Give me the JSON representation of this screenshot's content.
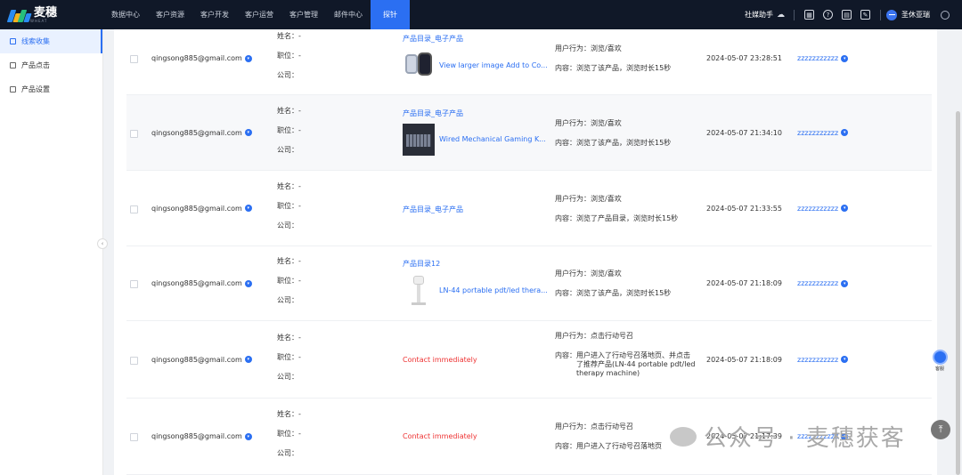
{
  "app": {
    "logo_text": "麦穗",
    "logo_sub": "WHEAT",
    "nav": [
      "数据中心",
      "客户资源",
      "客户开发",
      "客户运营",
      "客户管理",
      "邮件中心",
      "探针"
    ],
    "active_nav": "探针",
    "assistant": "社媒助手",
    "user": "圣休亚瑞",
    "accent": "#2b6ff2"
  },
  "sidebar": {
    "items": [
      {
        "label": "线索收集",
        "icon": "list-icon",
        "active": true
      },
      {
        "label": "产品点击",
        "icon": "click-icon",
        "active": false
      },
      {
        "label": "产品设置",
        "icon": "grid-icon",
        "active": false
      }
    ]
  },
  "labels": {
    "name": "姓名：-",
    "position": "职位：-",
    "company": "公司：",
    "behavior_prefix": "用户行为：",
    "content_prefix": "内容："
  },
  "rows": [
    {
      "email": "qingsong885@gmail.com",
      "category": "产品目录_电子产品",
      "product": "View larger image Add to Co...",
      "thumb": "watch",
      "behavior": "用户行为：浏览/喜欢",
      "content": "内容：浏览了该产品，浏览时长15秒",
      "time": "2024-05-07 23:28:51",
      "owner": "zzzzzzzzzzz"
    },
    {
      "email": "qingsong885@gmail.com",
      "category": "产品目录_电子产品",
      "product": "Wired Mechanical Gaming K...",
      "thumb": "keyboard",
      "behavior": "用户行为：浏览/喜欢",
      "content": "内容：浏览了该产品，浏览时长15秒",
      "time": "2024-05-07 21:34:10",
      "owner": "zzzzzzzzzzz"
    },
    {
      "email": "qingsong885@gmail.com",
      "category": "产品目录_电子产品",
      "product": "",
      "thumb": "",
      "behavior": "用户行为：浏览/喜欢",
      "content": "内容：浏览了产品目录，浏览时长15秒",
      "time": "2024-05-07 21:33:55",
      "owner": "zzzzzzzzzzz"
    },
    {
      "email": "qingsong885@gmail.com",
      "category": "产品目录12",
      "product": "LN-44 portable pdt/led thera...",
      "thumb": "device",
      "behavior": "用户行为：浏览/喜欢",
      "content": "内容：浏览了该产品，浏览时长15秒",
      "time": "2024-05-07 21:18:09",
      "owner": "zzzzzzzzzzz"
    },
    {
      "email": "qingsong885@gmail.com",
      "category": "Contact immediately",
      "product": "",
      "thumb": "",
      "behavior": "用户行为：点击行动号召",
      "content_lines": [
        "内容：用户进入了行动号召落地页、并点击",
        "了推荐产品(LN-44 portable pdt/led",
        "therapy machine)"
      ],
      "time": "2024-05-07 21:18:09",
      "owner": "zzzzzzzzzzz"
    },
    {
      "email": "qingsong885@gmail.com",
      "category": "Contact immediately",
      "product": "",
      "thumb": "",
      "behavior": "用户行为：点击行动号召",
      "content": "内容：用户进入了行动号召落地页",
      "time": "2024-05-07 21:17:39",
      "owner": "zzzzzzzzzzz"
    }
  ],
  "help_label": "客服",
  "watermark": "公众号 · 麦穗获客"
}
